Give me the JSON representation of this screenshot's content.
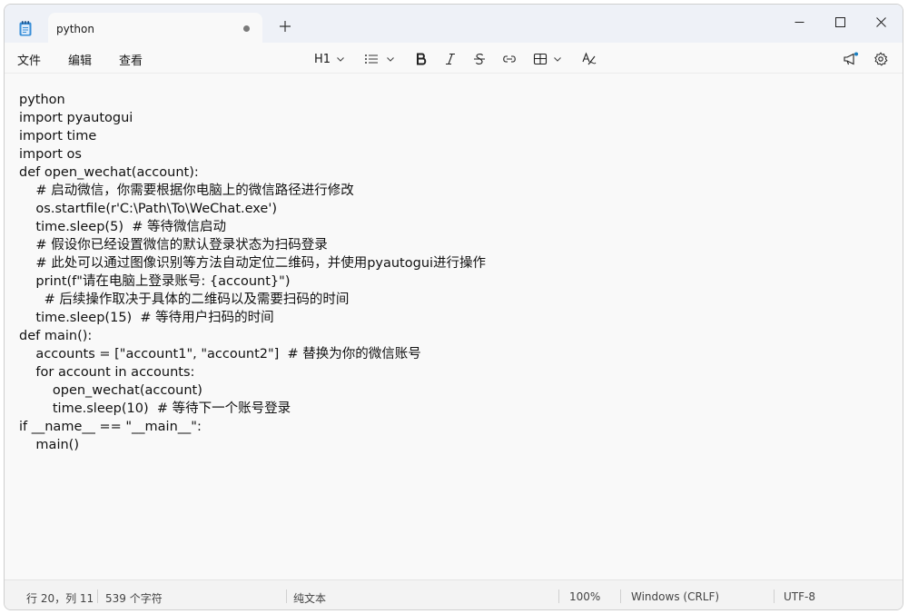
{
  "tab": {
    "title": "python"
  },
  "menu": {
    "file": "文件",
    "edit": "编辑",
    "view": "查看"
  },
  "toolbar": {
    "heading": "H1"
  },
  "editor": {
    "lines": [
      "python",
      "import pyautogui",
      "import time",
      "import os",
      "def open_wechat(account):",
      "    # 启动微信，你需要根据你电脑上的微信路径进行修改",
      "    os.startfile(r'C:\\Path\\To\\WeChat.exe')",
      "    time.sleep(5)  # 等待微信启动",
      "    # 假设你已经设置微信的默认登录状态为扫码登录",
      "    # 此处可以通过图像识别等方法自动定位二维码，并使用pyautogui进行操作",
      "    print(f\"请在电脑上登录账号: {account}\")",
      "      # 后续操作取决于具体的二维码以及需要扫码的时间",
      "    time.sleep(15)  # 等待用户扫码的时间",
      "def main():",
      "    accounts = [\"account1\", \"account2\"]  # 替换为你的微信账号",
      "    for account in accounts:",
      "        open_wechat(account)",
      "        time.sleep(10)  # 等待下一个账号登录",
      "if __name__ == \"__main__\":",
      "    main()"
    ]
  },
  "status": {
    "position": "行 20，列 11",
    "char_count": "539 个字符",
    "format": "纯文本",
    "zoom": "100%",
    "line_ending": "Windows (CRLF)",
    "encoding": "UTF-8"
  }
}
